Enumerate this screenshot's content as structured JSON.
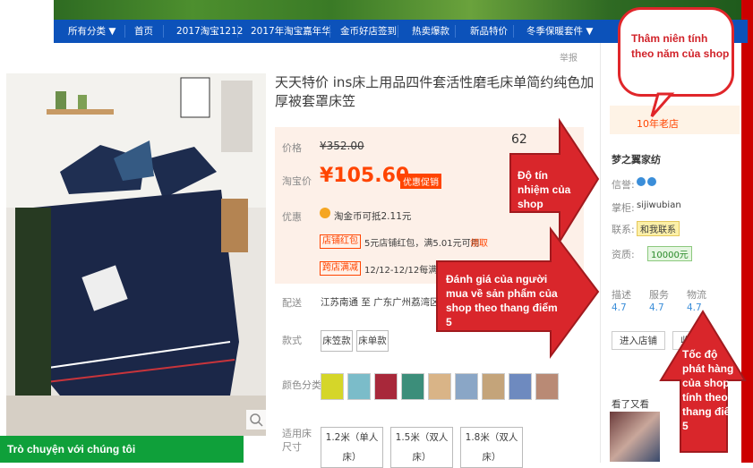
{
  "nav": {
    "items": [
      "所有分类 ▼",
      "首页",
      "2017淘宝1212",
      "2017年淘宝嘉年华",
      "金币好店签到",
      "热卖爆款",
      "新品特价",
      "冬季保暖套件 ▼"
    ]
  },
  "product": {
    "report_label": "举报",
    "title": "天天特价 ins床上用品四件套活性磨毛床单简约纯色加厚被套罩床笠",
    "price_label": "价格",
    "price_original": "¥352.00",
    "sale_label": "淘宝价",
    "sale_price": "¥105.60",
    "sale_badge": "优惠促销",
    "count": "62",
    "promo_label": "优惠",
    "promo_text": "淘金币可抵2.11元",
    "shop_redpack_tag": "店铺红包",
    "shop_redpack_text": "5元店铺红包，满5.01元可用",
    "shop_redpack_link": "领取",
    "crossshop_tag": "跨店满减",
    "crossshop_text": "12/12-12/12每满200",
    "delivery_label": "配送",
    "delivery_text": "江苏南通 至  广东广州荔湾区 ▼",
    "style_label": "款式",
    "style_options": [
      "床笠款",
      "床单款"
    ],
    "color_label": "颜色分类",
    "size_label": "适用床尺寸",
    "size_options": [
      "1.2米（单人床）",
      "1.5米（双人床）",
      "1.8米（双人床）"
    ]
  },
  "shop": {
    "years_badge": "10年老店",
    "name": "梦之翼家纺",
    "credit_label": "信誉:",
    "owner_label": "掌柜:",
    "owner_name": "sijiwubian",
    "contact_label": "联系:",
    "contact_btn": "和我联系",
    "deposit_label": "资质:",
    "deposit_value": "10000元",
    "ratings": [
      {
        "label": "描述",
        "score": "4.7"
      },
      {
        "label": "服务",
        "score": "4.7"
      },
      {
        "label": "物流",
        "score": "4.7"
      }
    ],
    "enter_btn": "进入店铺",
    "fav_btn": "收藏",
    "see_also": "看了又看"
  },
  "annotations": {
    "bubble": "Thâm niên tính theo năm của shop",
    "credit": "Độ tín nhiệm của shop",
    "rating": "Đánh giá của người mua về sản phẩm của shop theo thang điểm 5",
    "shipping": "Tốc độ phát hàng của shop tính theo thang điểm 5"
  },
  "chat": {
    "label": "Trò chuyện với chúng tôi"
  },
  "colors": {
    "accent": "#f40",
    "nav": "#0c52ba",
    "annotation": "#d1232a"
  }
}
